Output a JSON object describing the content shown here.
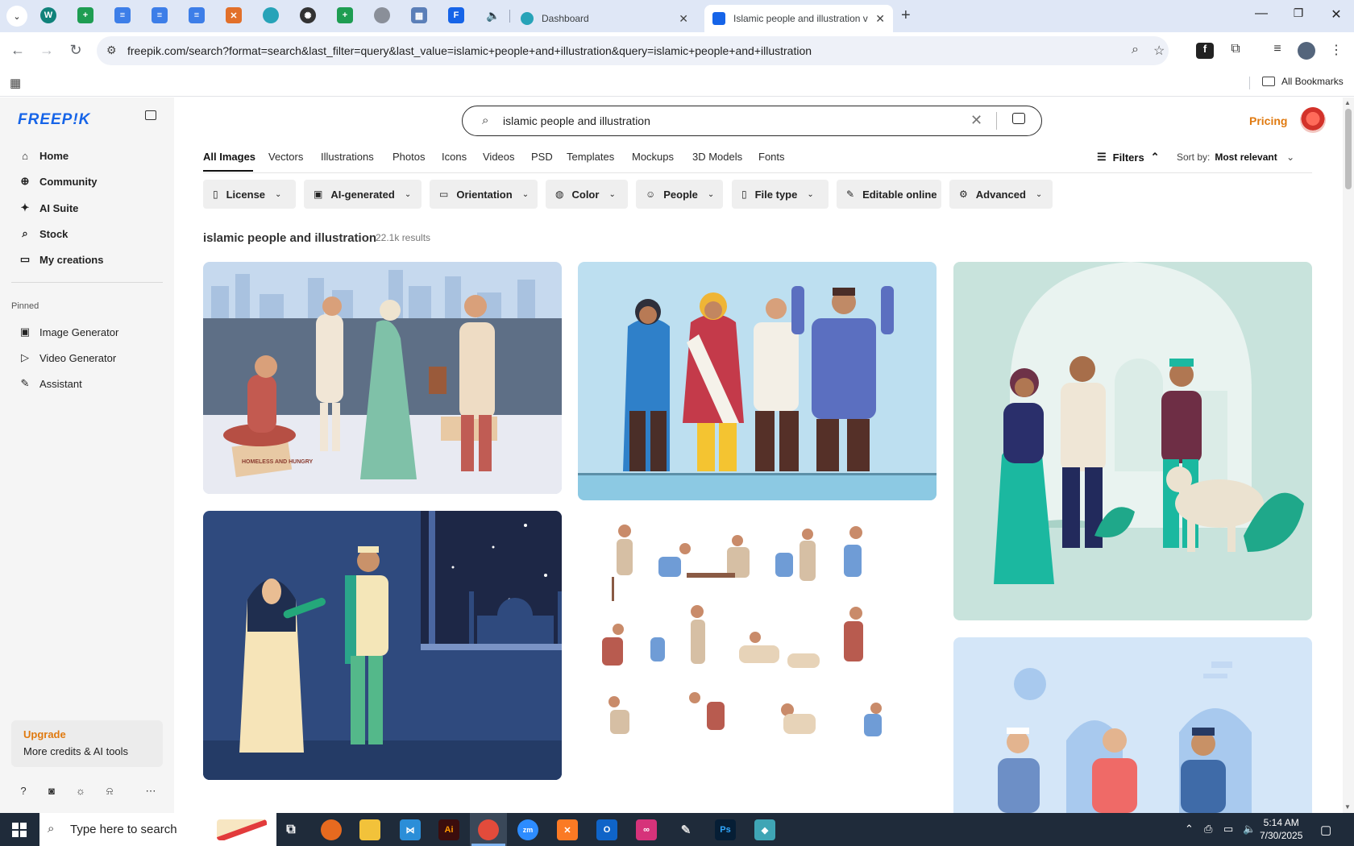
{
  "browser": {
    "tabs": [
      {
        "title": "Dashboard",
        "favicon_color": "#27a3b8"
      },
      {
        "title": "Islamic people and illustration v",
        "favicon_color": "#1664e8",
        "active": true
      }
    ],
    "url": "freepik.com/search?format=search&last_filter=query&last_value=islamic+people+and+illustration&query=islamic+people+and+illustration",
    "bookmarks_label": "All Bookmarks"
  },
  "freepik": {
    "logo": "FREEP!K",
    "nav": {
      "home": "Home",
      "community": "Community",
      "ai_suite": "AI Suite",
      "stock": "Stock",
      "my_creations": "My creations"
    },
    "pinned_heading": "Pinned",
    "pinned": {
      "image_generator": "Image Generator",
      "video_generator": "Video Generator",
      "assistant": "Assistant"
    },
    "upgrade": {
      "title": "Upgrade",
      "subtitle": "More credits & AI tools"
    },
    "search": {
      "value": "islamic people and illustration"
    },
    "pricing": "Pricing",
    "categories": [
      "All Images",
      "Vectors",
      "Illustrations",
      "Photos",
      "Icons",
      "Videos",
      "PSD",
      "Templates",
      "Mockups",
      "3D Models",
      "Fonts"
    ],
    "filters_label": "Filters",
    "sort": {
      "label": "Sort by:",
      "value": "Most relevant"
    },
    "chips": [
      "License",
      "AI-generated",
      "Orientation",
      "Color",
      "People",
      "File type",
      "Editable online",
      "Advanced"
    ],
    "results": {
      "title": "islamic people and illustration",
      "count": "22.1k results"
    },
    "sign_text": "HOMELESS AND HUNGRY"
  },
  "taskbar": {
    "search_placeholder": "Type here to search",
    "time": "5:14 AM",
    "date": "7/30/2025"
  }
}
